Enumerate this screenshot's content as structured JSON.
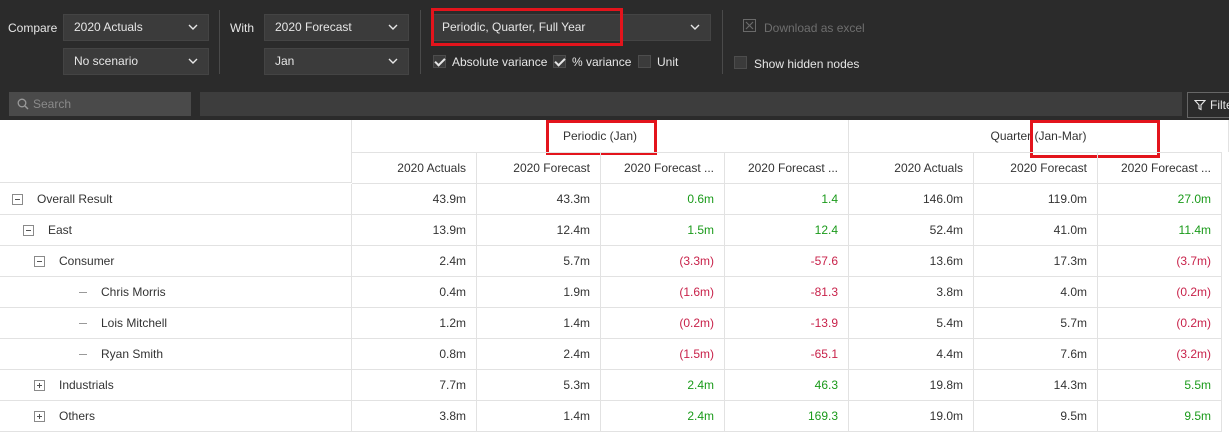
{
  "toolbar": {
    "compare_label": "Compare",
    "compare_value": "2020 Actuals",
    "compare_scenario": "No scenario",
    "with_label": "With",
    "with_value": "2020 Forecast",
    "with_period": "Jan",
    "view_value": "Periodic, Quarter, Full Year",
    "download_label": "Download as excel",
    "abs_variance_label": "Absolute variance",
    "abs_variance_checked": true,
    "pct_variance_label": "% variance",
    "pct_variance_checked": true,
    "unit_label": "Unit",
    "unit_checked": false,
    "hidden_nodes_label": "Show hidden nodes",
    "hidden_nodes_checked": false
  },
  "search": {
    "placeholder": "Search"
  },
  "filter": {
    "label": "Filter"
  },
  "grid": {
    "groups": [
      "Periodic (Jan)",
      "Quarter (Jan-Mar)"
    ],
    "columns": [
      "2020 Actuals",
      "2020 Forecast",
      "2020 Forecast ...",
      "2020 Forecast ...",
      "2020 Actuals",
      "2020 Forecast",
      "2020 Forecast ..."
    ],
    "rows": [
      {
        "label": "Overall Result",
        "level": 0,
        "toggle": "minus",
        "values": [
          "43.9m",
          "43.3m",
          "0.6m",
          "1.4",
          "146.0m",
          "119.0m",
          "27.0m"
        ]
      },
      {
        "label": "East",
        "level": 1,
        "toggle": "minus",
        "values": [
          "13.9m",
          "12.4m",
          "1.5m",
          "12.4",
          "52.4m",
          "41.0m",
          "11.4m"
        ]
      },
      {
        "label": "Consumer",
        "level": 2,
        "toggle": "minus",
        "values": [
          "2.4m",
          "5.7m",
          "(3.3m)",
          "-57.6",
          "13.6m",
          "17.3m",
          "(3.7m)"
        ]
      },
      {
        "label": "Chris Morris",
        "level": 3,
        "toggle": "leaf",
        "values": [
          "0.4m",
          "1.9m",
          "(1.6m)",
          "-81.3",
          "3.8m",
          "4.0m",
          "(0.2m)"
        ]
      },
      {
        "label": "Lois Mitchell",
        "level": 3,
        "toggle": "leaf",
        "values": [
          "1.2m",
          "1.4m",
          "(0.2m)",
          "-13.9",
          "5.4m",
          "5.7m",
          "(0.2m)"
        ]
      },
      {
        "label": "Ryan Smith",
        "level": 3,
        "toggle": "leaf",
        "values": [
          "0.8m",
          "2.4m",
          "(1.5m)",
          "-65.1",
          "4.4m",
          "7.6m",
          "(3.2m)"
        ]
      },
      {
        "label": "Industrials",
        "level": 2,
        "toggle": "plus",
        "values": [
          "7.7m",
          "5.3m",
          "2.4m",
          "46.3",
          "19.8m",
          "14.3m",
          "5.5m"
        ]
      },
      {
        "label": "Others",
        "level": 2,
        "toggle": "plus",
        "values": [
          "3.8m",
          "1.4m",
          "2.4m",
          "169.3",
          "19.0m",
          "9.5m",
          "9.5m"
        ]
      }
    ]
  },
  "colors": {
    "positive": "#1a9a1a",
    "negative": "#c8224a",
    "highlight": "#e3141c",
    "toolbar_bg": "#2b2b2b"
  },
  "icons": {
    "chevron": "chevron-down-icon",
    "search": "search-icon",
    "filter": "filter-icon",
    "excel": "excel-icon"
  }
}
